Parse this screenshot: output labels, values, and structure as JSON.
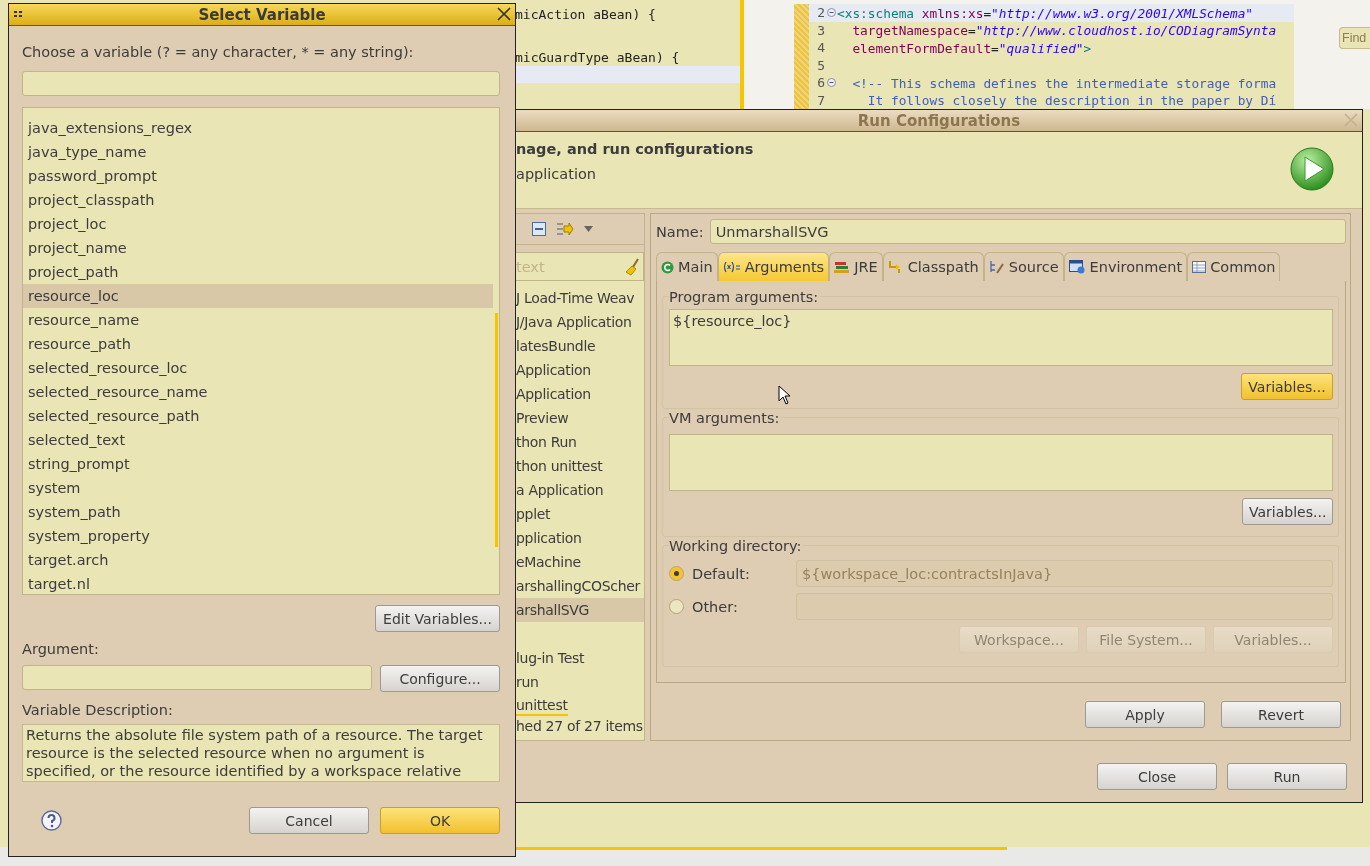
{
  "background": {
    "left_editor": {
      "lines": [
        "micAction aBean) {",
        "micGuardType aBean) {"
      ]
    },
    "xml_editor": {
      "lines": [
        {
          "number": "2",
          "fold": true,
          "current": true,
          "segments": [
            {
              "kind": "tag",
              "text": "<xs:schema"
            },
            {
              "kind": "attr",
              "text": " xmlns:xs"
            },
            {
              "kind": "plain",
              "text": "="
            },
            {
              "kind": "string",
              "text": "\"http://www.w3.org/2001/XMLSchema\""
            }
          ]
        },
        {
          "number": "3",
          "current": false,
          "segments": [
            {
              "kind": "attr",
              "text": "  targetNamespace"
            },
            {
              "kind": "plain",
              "text": "="
            },
            {
              "kind": "string",
              "text": "\"http://www.cloudhost.io/CODiagramSynta"
            }
          ]
        },
        {
          "number": "4",
          "current": false,
          "segments": [
            {
              "kind": "attr",
              "text": "  elementFormDefault"
            },
            {
              "kind": "plain",
              "text": "="
            },
            {
              "kind": "string",
              "text": "\"qualified\""
            },
            {
              "kind": "tag",
              "text": ">"
            }
          ]
        },
        {
          "number": "5",
          "current": false
        },
        {
          "number": "6",
          "fold": true,
          "current": false,
          "segments": [
            {
              "kind": "comment",
              "text": "  <!-- This schema defines the intermediate storage forma"
            }
          ]
        },
        {
          "number": "7",
          "current": false,
          "segments": [
            {
              "kind": "comment",
              "text": "    It follows closely the description in the paper by Dí"
            }
          ]
        }
      ]
    },
    "find_field": {
      "placeholder": "Find"
    }
  },
  "run_configurations": {
    "title": "Run Configurations",
    "header": {
      "heading": "nage, and run configurations",
      "subtitle": "application"
    },
    "filter": {
      "placeholder": "text"
    },
    "launch_configs": [
      {
        "kind": "entry",
        "label": "J Load-Time Weav",
        "selected": false,
        "underlined": false
      },
      {
        "kind": "entry",
        "label": "J/Java Application",
        "selected": false,
        "underlined": false
      },
      {
        "kind": "entry",
        "label": "latesBundle",
        "selected": false,
        "underlined": false
      },
      {
        "kind": "entry",
        "label": "Application",
        "selected": false,
        "underlined": false
      },
      {
        "kind": "entry",
        "label": "Application",
        "selected": false,
        "underlined": false
      },
      {
        "kind": "entry",
        "label": "Preview",
        "selected": false,
        "underlined": false
      },
      {
        "kind": "entry",
        "label": "thon Run",
        "selected": false,
        "underlined": false
      },
      {
        "kind": "entry",
        "label": "thon unittest",
        "selected": false,
        "underlined": false
      },
      {
        "kind": "entry",
        "label": "a Application",
        "selected": false,
        "underlined": false
      },
      {
        "kind": "entry",
        "label": "pplet",
        "selected": false,
        "underlined": false
      },
      {
        "kind": "entry",
        "label": "pplication",
        "selected": false,
        "underlined": false
      },
      {
        "kind": "entry",
        "label": "eMachine",
        "selected": false,
        "underlined": false
      },
      {
        "kind": "entry",
        "label": "arshallingCOScher",
        "selected": false,
        "underlined": false
      },
      {
        "kind": "entry",
        "label": "arshallSVG",
        "selected": true,
        "underlined": false
      },
      {
        "kind": "hidden"
      },
      {
        "kind": "entry",
        "label": "lug-in Test",
        "selected": false,
        "underlined": false
      },
      {
        "kind": "entry",
        "label": "run",
        "selected": false,
        "underlined": false
      },
      {
        "kind": "entry",
        "label": "unittest",
        "selected": false,
        "underlined": true
      }
    ],
    "status": "hed 27 of 27 items",
    "name": {
      "label": "Name:",
      "value": "UnmarshallSVG"
    },
    "tabs": [
      {
        "kind": "main",
        "label": "Main",
        "selected": false
      },
      {
        "kind": "arguments",
        "label": "Arguments",
        "selected": true
      },
      {
        "kind": "jre",
        "label": "JRE",
        "selected": false
      },
      {
        "kind": "classpath",
        "label": "Classpath",
        "selected": false
      },
      {
        "kind": "source",
        "label": "Source",
        "selected": false
      },
      {
        "kind": "environment",
        "label": "Environment",
        "selected": false
      },
      {
        "kind": "common",
        "label": "Common",
        "selected": false
      }
    ],
    "program_arguments": {
      "label": "Program arguments:",
      "value": "${resource_loc}",
      "button": {
        "label": "Variables...",
        "disabled": false,
        "highlighted": true
      }
    },
    "vm_arguments": {
      "label": "VM arguments:",
      "button": {
        "label": "Variables...",
        "disabled": false,
        "highlighted": false
      }
    },
    "working_directory": {
      "label": "Working directory:",
      "options": [
        {
          "label": "Default:",
          "selected": true,
          "value": "${workspace_loc:contractsInJava}"
        },
        {
          "label": "Other:",
          "selected": false
        }
      ],
      "buttons": [
        {
          "label": "Workspace...",
          "disabled": true
        },
        {
          "label": "File System...",
          "disabled": true
        },
        {
          "label": "Variables...",
          "disabled": true
        }
      ]
    },
    "edit_buttons": [
      {
        "label": "Apply",
        "disabled": false,
        "highlighted": false
      },
      {
        "label": "Revert",
        "disabled": false,
        "highlighted": false
      }
    ],
    "dialog_buttons": [
      {
        "label": "Close",
        "disabled": false,
        "highlighted": false
      },
      {
        "label": "Run",
        "disabled": false,
        "highlighted": false
      }
    ]
  },
  "select_variable": {
    "title": "Select Variable",
    "prompt": "Choose a variable (? = any character, * = any string):",
    "variables": [
      {
        "name": "java_extensions_regex",
        "selected": false
      },
      {
        "name": "java_type_name",
        "selected": false
      },
      {
        "name": "password_prompt",
        "selected": false
      },
      {
        "name": "project_classpath",
        "selected": false
      },
      {
        "name": "project_loc",
        "selected": false
      },
      {
        "name": "project_name",
        "selected": false
      },
      {
        "name": "project_path",
        "selected": false
      },
      {
        "name": "resource_loc",
        "selected": true
      },
      {
        "name": "resource_name",
        "selected": false
      },
      {
        "name": "resource_path",
        "selected": false
      },
      {
        "name": "selected_resource_loc",
        "selected": false
      },
      {
        "name": "selected_resource_name",
        "selected": false
      },
      {
        "name": "selected_resource_path",
        "selected": false
      },
      {
        "name": "selected_text",
        "selected": false
      },
      {
        "name": "string_prompt",
        "selected": false
      },
      {
        "name": "system",
        "selected": false
      },
      {
        "name": "system_path",
        "selected": false
      },
      {
        "name": "system_property",
        "selected": false
      },
      {
        "name": "target.arch",
        "selected": false
      },
      {
        "name": "target.nl",
        "selected": false
      }
    ],
    "edit_button": {
      "label": "Edit Variables...",
      "disabled": false,
      "highlighted": false
    },
    "argument": {
      "label": "Argument:",
      "button": {
        "label": "Configure...",
        "disabled": false,
        "highlighted": false
      }
    },
    "description": {
      "label": "Variable Description:",
      "text": "Returns the absolute file system path of a resource. The target resource is the selected resource when no argument is specified, or the resource identified by a workspace relative"
    },
    "buttons": [
      {
        "label": "Cancel",
        "disabled": false,
        "highlighted": false
      },
      {
        "label": "OK",
        "disabled": false,
        "highlighted": true
      }
    ]
  }
}
